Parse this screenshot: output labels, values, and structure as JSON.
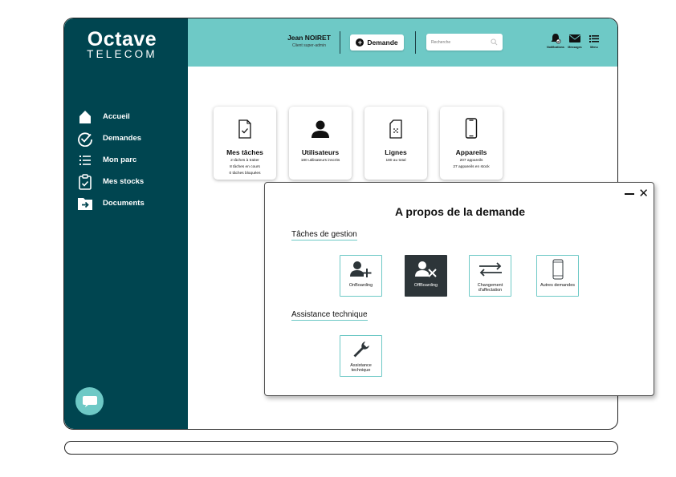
{
  "brand": {
    "logo_top": "Octave",
    "logo_bottom": "TELECOM"
  },
  "sidebar": {
    "items": [
      {
        "label": "Accueil",
        "icon": "home-icon"
      },
      {
        "label": "Demandes",
        "icon": "check-circle-icon"
      },
      {
        "label": "Mon parc",
        "icon": "list-icon"
      },
      {
        "label": "Mes stocks",
        "icon": "clipboard-icon"
      },
      {
        "label": "Documents",
        "icon": "folder-arrow-icon"
      }
    ],
    "chat_icon": "chat-bubble-icon"
  },
  "header": {
    "user_name": "Jean NOIRET",
    "user_role": "Client super-admin",
    "demande_label": "Demande",
    "search_placeholder": "Recherche",
    "icons": [
      {
        "caption": "Notifications",
        "icon": "bell-icon"
      },
      {
        "caption": "Messages",
        "icon": "mail-icon"
      },
      {
        "caption": "Menu",
        "icon": "menu-icon"
      }
    ]
  },
  "cards": [
    {
      "title": "Mes tâches",
      "icon": "task-file-icon",
      "lines": [
        "2 tâches à traiter",
        "8 tâches en cours",
        "0 tâches bloquées"
      ]
    },
    {
      "title": "Utilisateurs",
      "icon": "user-icon",
      "lines": [
        "180 utilisateurs inscrits"
      ]
    },
    {
      "title": "Lignes",
      "icon": "sim-card-icon",
      "lines": [
        "180 au total"
      ]
    },
    {
      "title": "Appareils",
      "icon": "phone-icon",
      "lines": [
        "207 appareils",
        "27 appareils en stock"
      ]
    }
  ],
  "modal": {
    "title": "A propos de la demande",
    "sections": [
      {
        "title": "Tâches de gestion",
        "options": [
          {
            "label": "OnBoarding",
            "icon": "user-add-icon",
            "selected": false
          },
          {
            "label": "OffBoarding",
            "icon": "user-remove-icon",
            "selected": true
          },
          {
            "label": "Changement d'affectation",
            "icon": "swap-arrows-icon",
            "selected": false
          },
          {
            "label": "Autres demandes",
            "icon": "phone-outline-icon",
            "selected": false
          }
        ]
      },
      {
        "title": "Assistance technique",
        "options": [
          {
            "label": "Assistance technique",
            "icon": "wrench-icon",
            "selected": false
          }
        ]
      }
    ]
  }
}
